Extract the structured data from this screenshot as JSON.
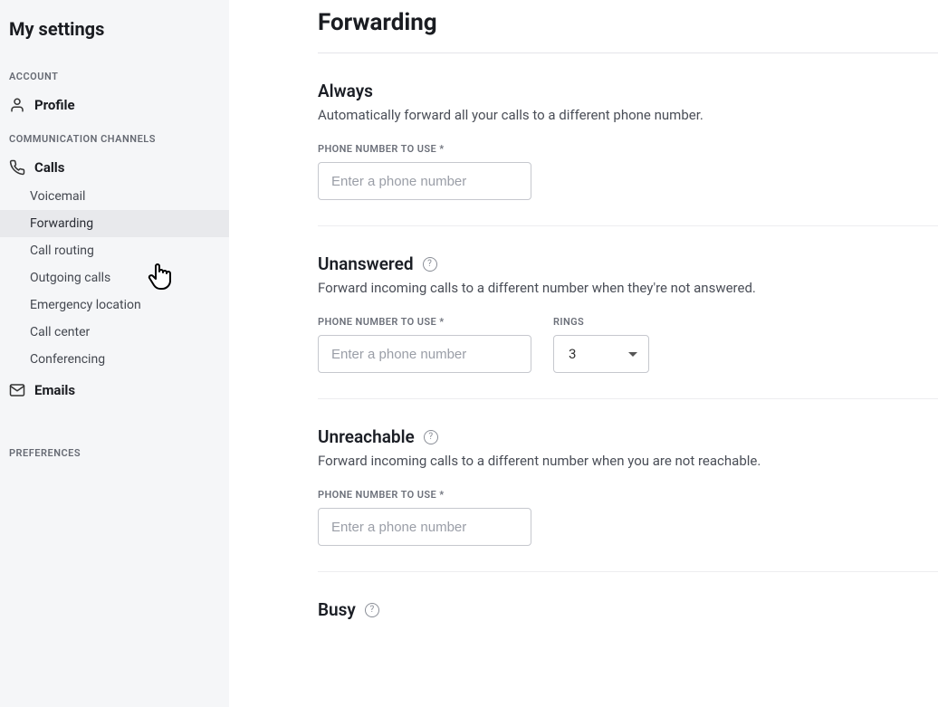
{
  "sidebar": {
    "title": "My settings",
    "groups": [
      {
        "label": "ACCOUNT",
        "items": [
          {
            "name": "profile",
            "label": "Profile",
            "icon": "user-icon"
          }
        ]
      },
      {
        "label": "COMMUNICATION CHANNELS",
        "items": [
          {
            "name": "calls",
            "label": "Calls",
            "icon": "phone-icon",
            "children": [
              {
                "name": "voicemail",
                "label": "Voicemail",
                "active": false
              },
              {
                "name": "forwarding",
                "label": "Forwarding",
                "active": true
              },
              {
                "name": "call-routing",
                "label": "Call routing",
                "active": false
              },
              {
                "name": "outgoing-calls",
                "label": "Outgoing calls",
                "active": false
              },
              {
                "name": "emergency-location",
                "label": "Emergency location",
                "active": false
              },
              {
                "name": "call-center",
                "label": "Call center",
                "active": false
              },
              {
                "name": "conferencing",
                "label": "Conferencing",
                "active": false
              }
            ]
          },
          {
            "name": "emails",
            "label": "Emails",
            "icon": "mail-icon"
          }
        ]
      },
      {
        "label": "PREFERENCES",
        "items": []
      }
    ]
  },
  "page": {
    "title": "Forwarding",
    "sections": {
      "always": {
        "title": "Always",
        "desc": "Automatically forward all your calls to a different phone number.",
        "phone_label": "PHONE NUMBER TO USE *",
        "phone_placeholder": "Enter a phone number"
      },
      "unanswered": {
        "title": "Unanswered",
        "desc": "Forward incoming calls to a different number when they're not answered.",
        "phone_label": "PHONE NUMBER TO USE *",
        "phone_placeholder": "Enter a phone number",
        "rings_label": "RINGS",
        "rings_value": "3"
      },
      "unreachable": {
        "title": "Unreachable",
        "desc": "Forward incoming calls to a different number when you are not reachable.",
        "phone_label": "PHONE NUMBER TO USE *",
        "phone_placeholder": "Enter a phone number"
      },
      "busy": {
        "title": "Busy"
      }
    }
  }
}
